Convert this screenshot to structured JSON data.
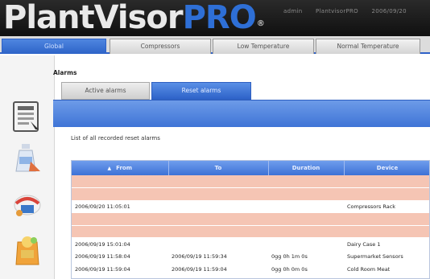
{
  "header": {
    "logo_main": "PlantVisor",
    "logo_pro": "PRO",
    "logo_reg": "®",
    "user": "admin",
    "site": "PlantvisorPRO",
    "date": "2006/09/20"
  },
  "menu": {
    "tabs": [
      {
        "label": "Global"
      },
      {
        "label": "Compressors"
      },
      {
        "label": "Low Temperature"
      },
      {
        "label": "Normal Temperature"
      }
    ]
  },
  "page": {
    "section_title": "Alarms",
    "subtabs": [
      {
        "label": "Active alarms"
      },
      {
        "label": "Reset alarms"
      }
    ],
    "caption": "List of all recorded reset alarms"
  },
  "table": {
    "columns": [
      "From",
      "To",
      "Duration",
      "Device"
    ],
    "rows": [
      {
        "state": "alarm",
        "from": "",
        "to": "",
        "duration": "",
        "device": ""
      },
      {
        "state": "alarm",
        "from": "",
        "to": "",
        "duration": "",
        "device": ""
      },
      {
        "state": "normal",
        "from": "2006/09/20 11:05:01",
        "to": "",
        "duration": "",
        "device": "Compressors Rack"
      },
      {
        "state": "alarm",
        "from": "",
        "to": "",
        "duration": "",
        "device": ""
      },
      {
        "state": "alarm",
        "from": "",
        "to": "",
        "duration": "",
        "device": ""
      },
      {
        "state": "normal",
        "from": "2006/09/19 15:01:04",
        "to": "",
        "duration": "",
        "device": "Dairy Case 1"
      },
      {
        "state": "normal",
        "from": "2006/09/19 11:58:04",
        "to": "2006/09/19 11:59:34",
        "duration": "0gg 0h 1m 0s",
        "device": "Supermarket Sensors"
      },
      {
        "state": "normal",
        "from": "2006/09/19 11:59:04",
        "to": "2006/09/19 11:59:04",
        "duration": "0gg 0h 0m 0s",
        "device": "Cold Room Meat"
      }
    ]
  }
}
